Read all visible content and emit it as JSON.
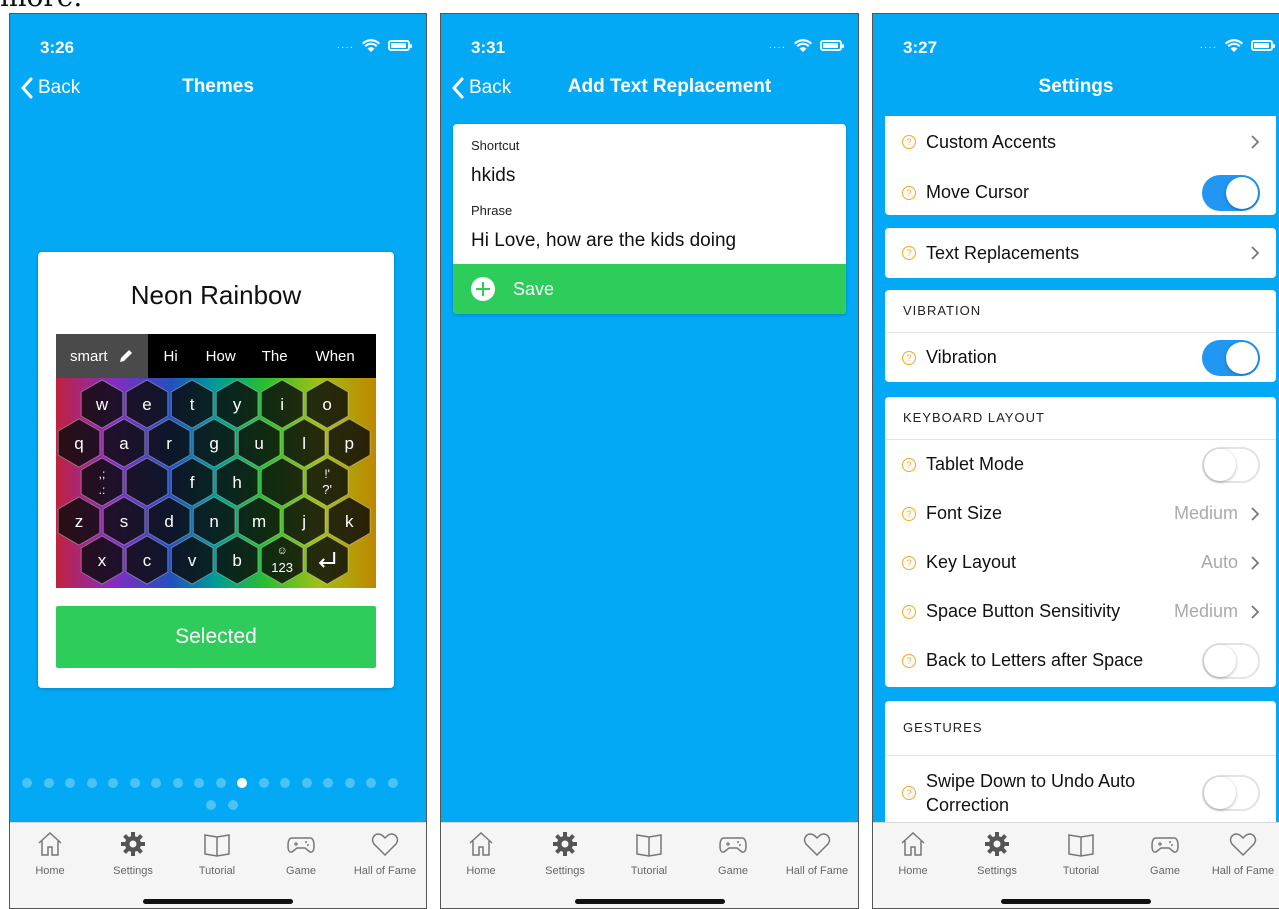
{
  "caption_fragment": "more.",
  "tabs": [
    {
      "label": "Home",
      "icon": "home-icon"
    },
    {
      "label": "Settings",
      "icon": "gear-icon"
    },
    {
      "label": "Tutorial",
      "icon": "book-icon"
    },
    {
      "label": "Game",
      "icon": "gamepad-icon"
    },
    {
      "label": "Hall of Fame",
      "icon": "heart-icon"
    }
  ],
  "phone1": {
    "time": "3:26",
    "back": "Back",
    "title": "Themes",
    "theme_name": "Neon Rainbow",
    "keyboard": {
      "smart": "smart",
      "suggestions": [
        "Hi",
        "How",
        "The",
        "When"
      ],
      "row1": [
        "w",
        "e",
        "t",
        "y",
        "i",
        "o"
      ],
      "row2": [
        "q",
        "a",
        "r",
        "g",
        "u",
        "l",
        "p"
      ],
      "row3": [
        "f",
        "h"
      ],
      "row4": [
        "z",
        "s",
        "d",
        "n",
        "m",
        "j",
        "k"
      ],
      "row5": [
        "x",
        "c",
        "v",
        "b",
        "123"
      ],
      "punct_left_top": ",;",
      "punct_left_bottom": ".:",
      "punct_right_top": "!'",
      "punct_right_bottom": "?'",
      "emoji": "☺"
    },
    "selected_button": "Selected",
    "page_count": 20,
    "active_page": 11
  },
  "phone2": {
    "time": "3:31",
    "back": "Back",
    "title": "Add Text Replacement",
    "shortcut_label": "Shortcut",
    "shortcut_value": "hkids",
    "phrase_label": "Phrase",
    "phrase_value": "Hi Love, how are the kids doing",
    "save": "Save"
  },
  "phone3": {
    "time": "3:27",
    "title": "Settings",
    "custom_accents": "Custom Accents",
    "move_cursor": "Move Cursor",
    "text_replacements": "Text Replacements",
    "vibration_header": "VIBRATION",
    "vibration": "Vibration",
    "keyboard_layout_header": "KEYBOARD LAYOUT",
    "tablet_mode": "Tablet Mode",
    "font_size": "Font Size",
    "font_size_value": "Medium",
    "key_layout": "Key Layout",
    "key_layout_value": "Auto",
    "space_sensitivity": "Space Button Sensitivity",
    "space_sensitivity_value": "Medium",
    "back_to_letters": "Back to Letters after Space",
    "gestures_header": "GESTURES",
    "swipe_down_line1": "Swipe Down to Undo Auto",
    "swipe_down_line2": "Correction",
    "help_glyph": "?"
  },
  "colors": {
    "accent_blue": "#03a9f4",
    "toggle_on": "#2196f3",
    "save_green": "#2ecc5a",
    "help_orange": "#f5a623"
  }
}
